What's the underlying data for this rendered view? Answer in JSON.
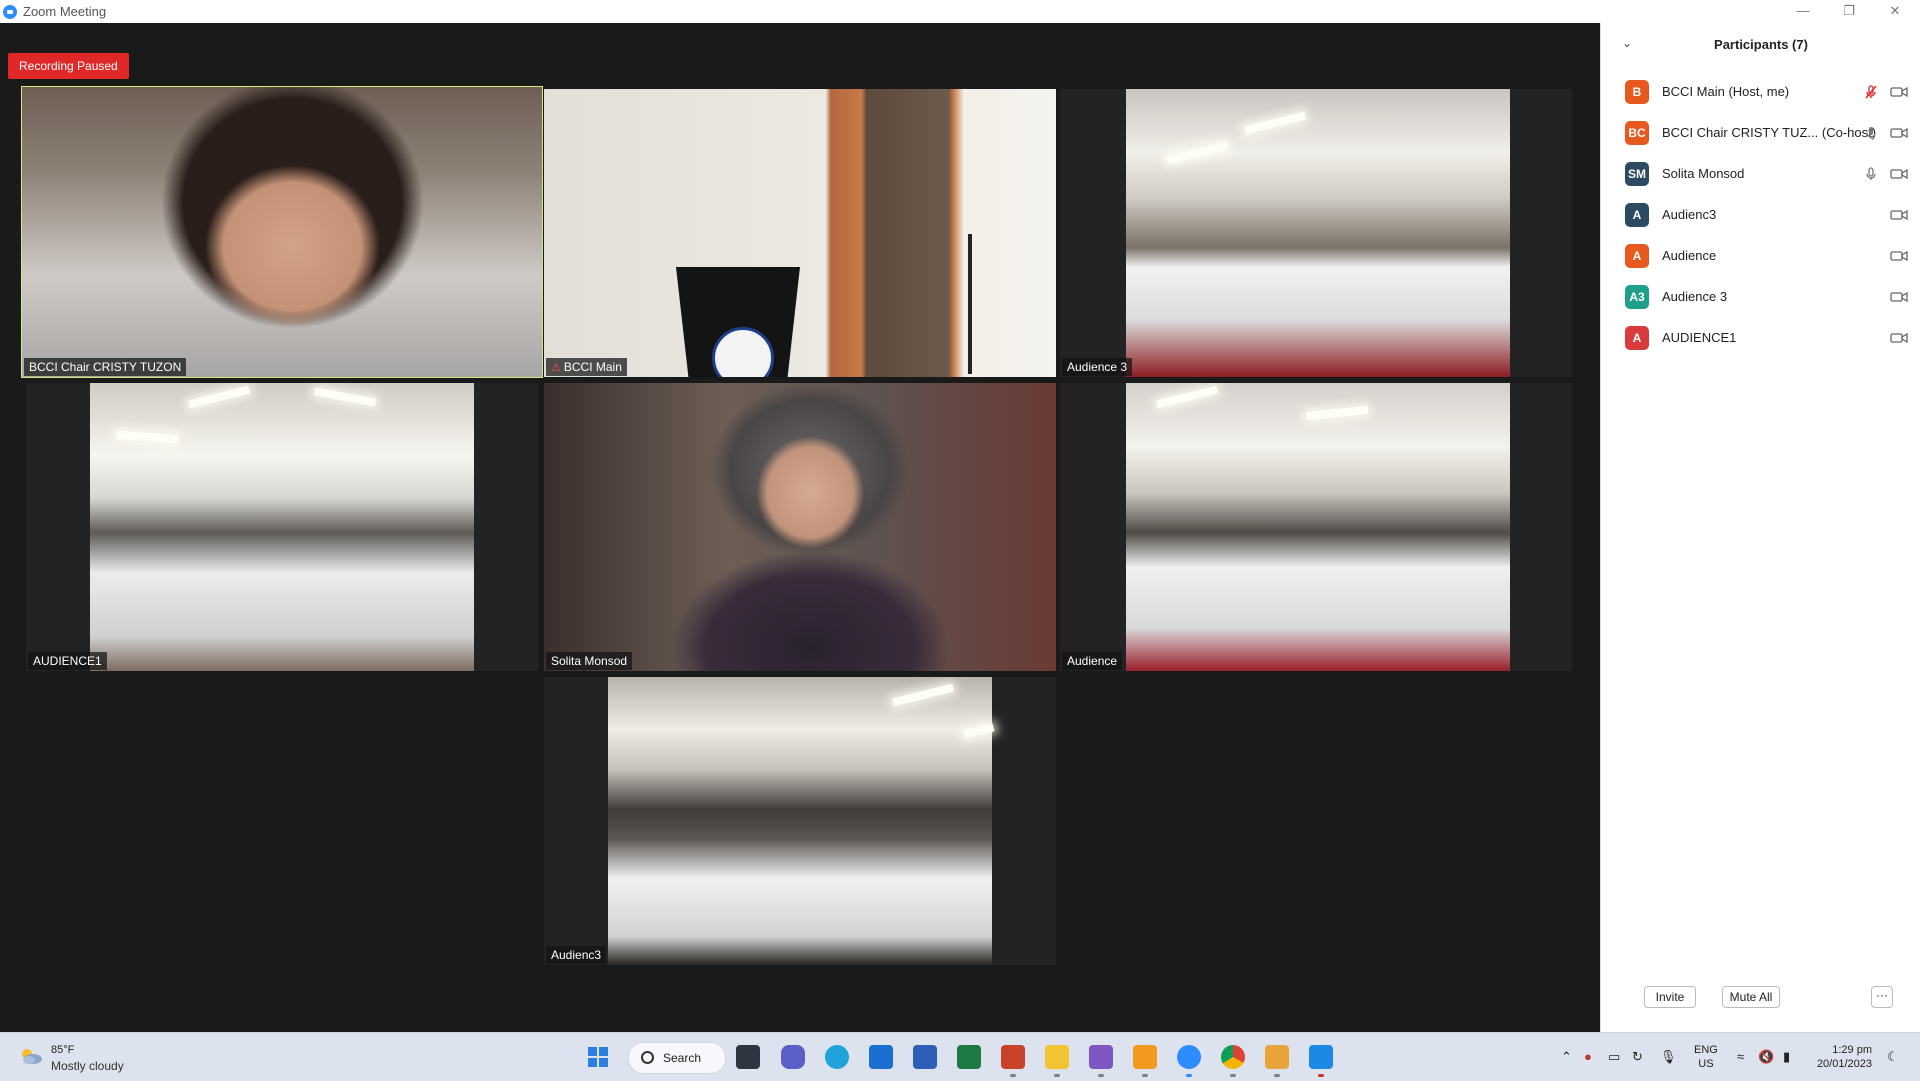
{
  "window": {
    "title": "Zoom Meeting"
  },
  "recording": {
    "label": "Recording Paused"
  },
  "tiles": [
    {
      "name": "BCCI Chair CRISTY TUZON",
      "muted": false,
      "active": true
    },
    {
      "name": "BCCI Main",
      "muted": true,
      "active": false
    },
    {
      "name": "Audience 3",
      "muted": false,
      "active": false
    },
    {
      "name": "AUDIENCE1",
      "muted": false,
      "active": false
    },
    {
      "name": "Solita Monsod",
      "muted": false,
      "active": false
    },
    {
      "name": "Audience",
      "muted": false,
      "active": false
    },
    {
      "name": "Audienc3",
      "muted": false,
      "active": false
    }
  ],
  "participants": {
    "title": "Participants (7)",
    "items": [
      {
        "initials": "B",
        "name": "BCCI Main (Host, me)",
        "color": "#e8591f",
        "mic": "muted"
      },
      {
        "initials": "BC",
        "name": "BCCI Chair CRISTY TUZ... (Co-host)",
        "color": "#e8591f",
        "mic": "on"
      },
      {
        "initials": "SM",
        "name": "Solita Monsod",
        "color": "#2d4a63",
        "mic": "on"
      },
      {
        "initials": "A",
        "name": "Audienc3",
        "color": "#2d4a63",
        "mic": "none"
      },
      {
        "initials": "A",
        "name": "Audience",
        "color": "#e8591f",
        "mic": "none"
      },
      {
        "initials": "A3",
        "name": "Audience 3",
        "color": "#1f9e8a",
        "mic": "none"
      },
      {
        "initials": "A",
        "name": "AUDIENCE1",
        "color": "#d83b3b",
        "mic": "none"
      }
    ],
    "invite_label": "Invite",
    "mute_all_label": "Mute All",
    "more_label": "···"
  },
  "taskbar": {
    "weather_temp": "85°F",
    "weather_desc": "Mostly cloudy",
    "search_label": "Search",
    "lang_top": "ENG",
    "lang_bottom": "US",
    "time": "1:29 pm",
    "date": "20/01/2023",
    "apps": [
      "file-manager-icon",
      "teams-icon",
      "edge-icon",
      "mail-icon",
      "word-icon",
      "excel-icon",
      "powerpoint-icon",
      "explorer-icon",
      "clipchamp-icon",
      "slides-icon",
      "zoom-icon",
      "chrome-icon",
      "media-player-icon",
      "camera-app-icon"
    ]
  }
}
